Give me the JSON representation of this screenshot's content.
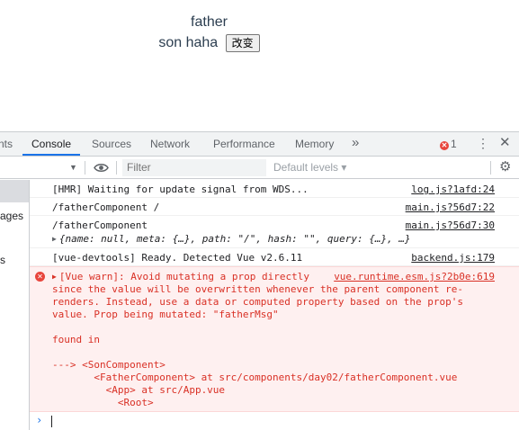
{
  "page": {
    "father_text": "father",
    "son_text": "son haha",
    "change_button": "改变"
  },
  "tabs": [
    {
      "label": "nts",
      "active": false
    },
    {
      "label": "Console",
      "active": true
    },
    {
      "label": "Sources",
      "active": false
    },
    {
      "label": "Network",
      "active": false
    },
    {
      "label": "Performance",
      "active": false
    },
    {
      "label": "Memory",
      "active": false
    }
  ],
  "more_tabs": "»",
  "error_count": "1",
  "toolbar": {
    "filter_placeholder": "Filter",
    "levels": "Default levels ▾"
  },
  "sidebar": [
    "ages",
    "s"
  ],
  "console": {
    "messages": [
      {
        "text": "[HMR] Waiting for update signal from WDS...",
        "source": "log.js?1afd:24"
      },
      {
        "text": "/fatherComponent /",
        "source": "main.js?56d7:22"
      },
      {
        "text": "/fatherComponent",
        "source": "main.js?56d7:30",
        "detail": "{name: null, meta: {…}, path: \"/\", hash: \"\", query: {…}, …}"
      },
      {
        "text": "[vue-devtools] Ready. Detected Vue v2.6.11",
        "source": "backend.js:179"
      }
    ],
    "warning": {
      "source": "vue.runtime.esm.js?2b0e:619",
      "lines": [
        "[Vue warn]: Avoid mutating a prop directly",
        "since the value will be overwritten whenever the parent component re-",
        "renders. Instead, use a data or computed property based on the prop's",
        "value. Prop being mutated: \"fatherMsg\"",
        "",
        "found in",
        "",
        "---> <SonComponent>",
        "       <FatherComponent> at src/components/day02/fatherComponent.vue",
        "         <App> at src/App.vue",
        "           <Root>"
      ]
    },
    "prompt_symbol": "›"
  },
  "colors": {
    "accent": "#1a73e8",
    "error": "#d93025",
    "error_bg": "#fef0f0",
    "vue_text": "#2c3e50"
  }
}
